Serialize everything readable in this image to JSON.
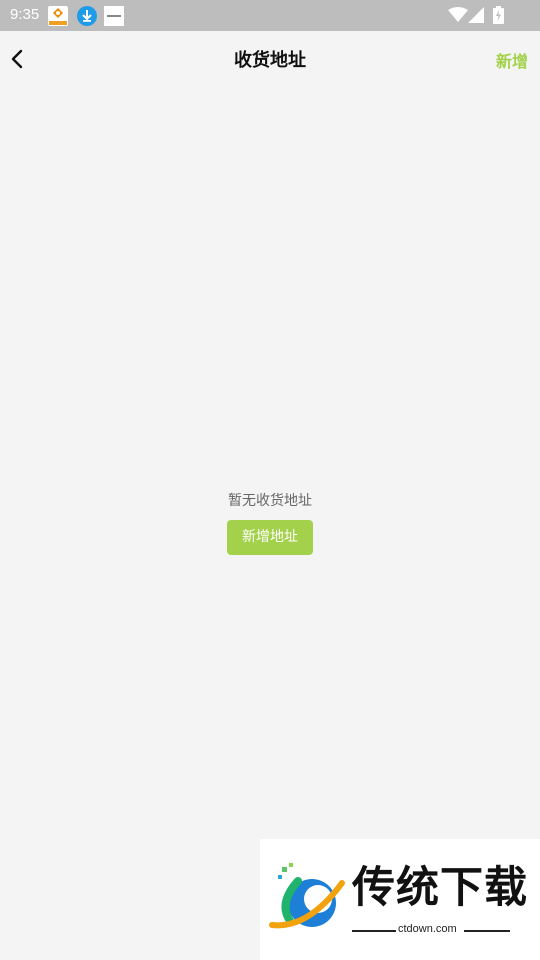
{
  "status_bar": {
    "time": "9:35",
    "notification_icons": [
      "app-badge-icon",
      "download-icon",
      "notification-thumbnail-icon"
    ],
    "system_icons": [
      "wifi-icon",
      "signal-icon",
      "battery-charging-icon"
    ]
  },
  "header": {
    "back_icon": "chevron-left-icon",
    "title": "收货地址",
    "action_label": "新增"
  },
  "empty_state": {
    "message": "暂无收货地址",
    "button_label": "新增地址"
  },
  "watermark": {
    "brand": "传统下载",
    "url": "ctdown.com"
  },
  "colors": {
    "accent": "#a3d14b",
    "status_bar": "#bdbdbd",
    "background": "#f4f4f4"
  }
}
